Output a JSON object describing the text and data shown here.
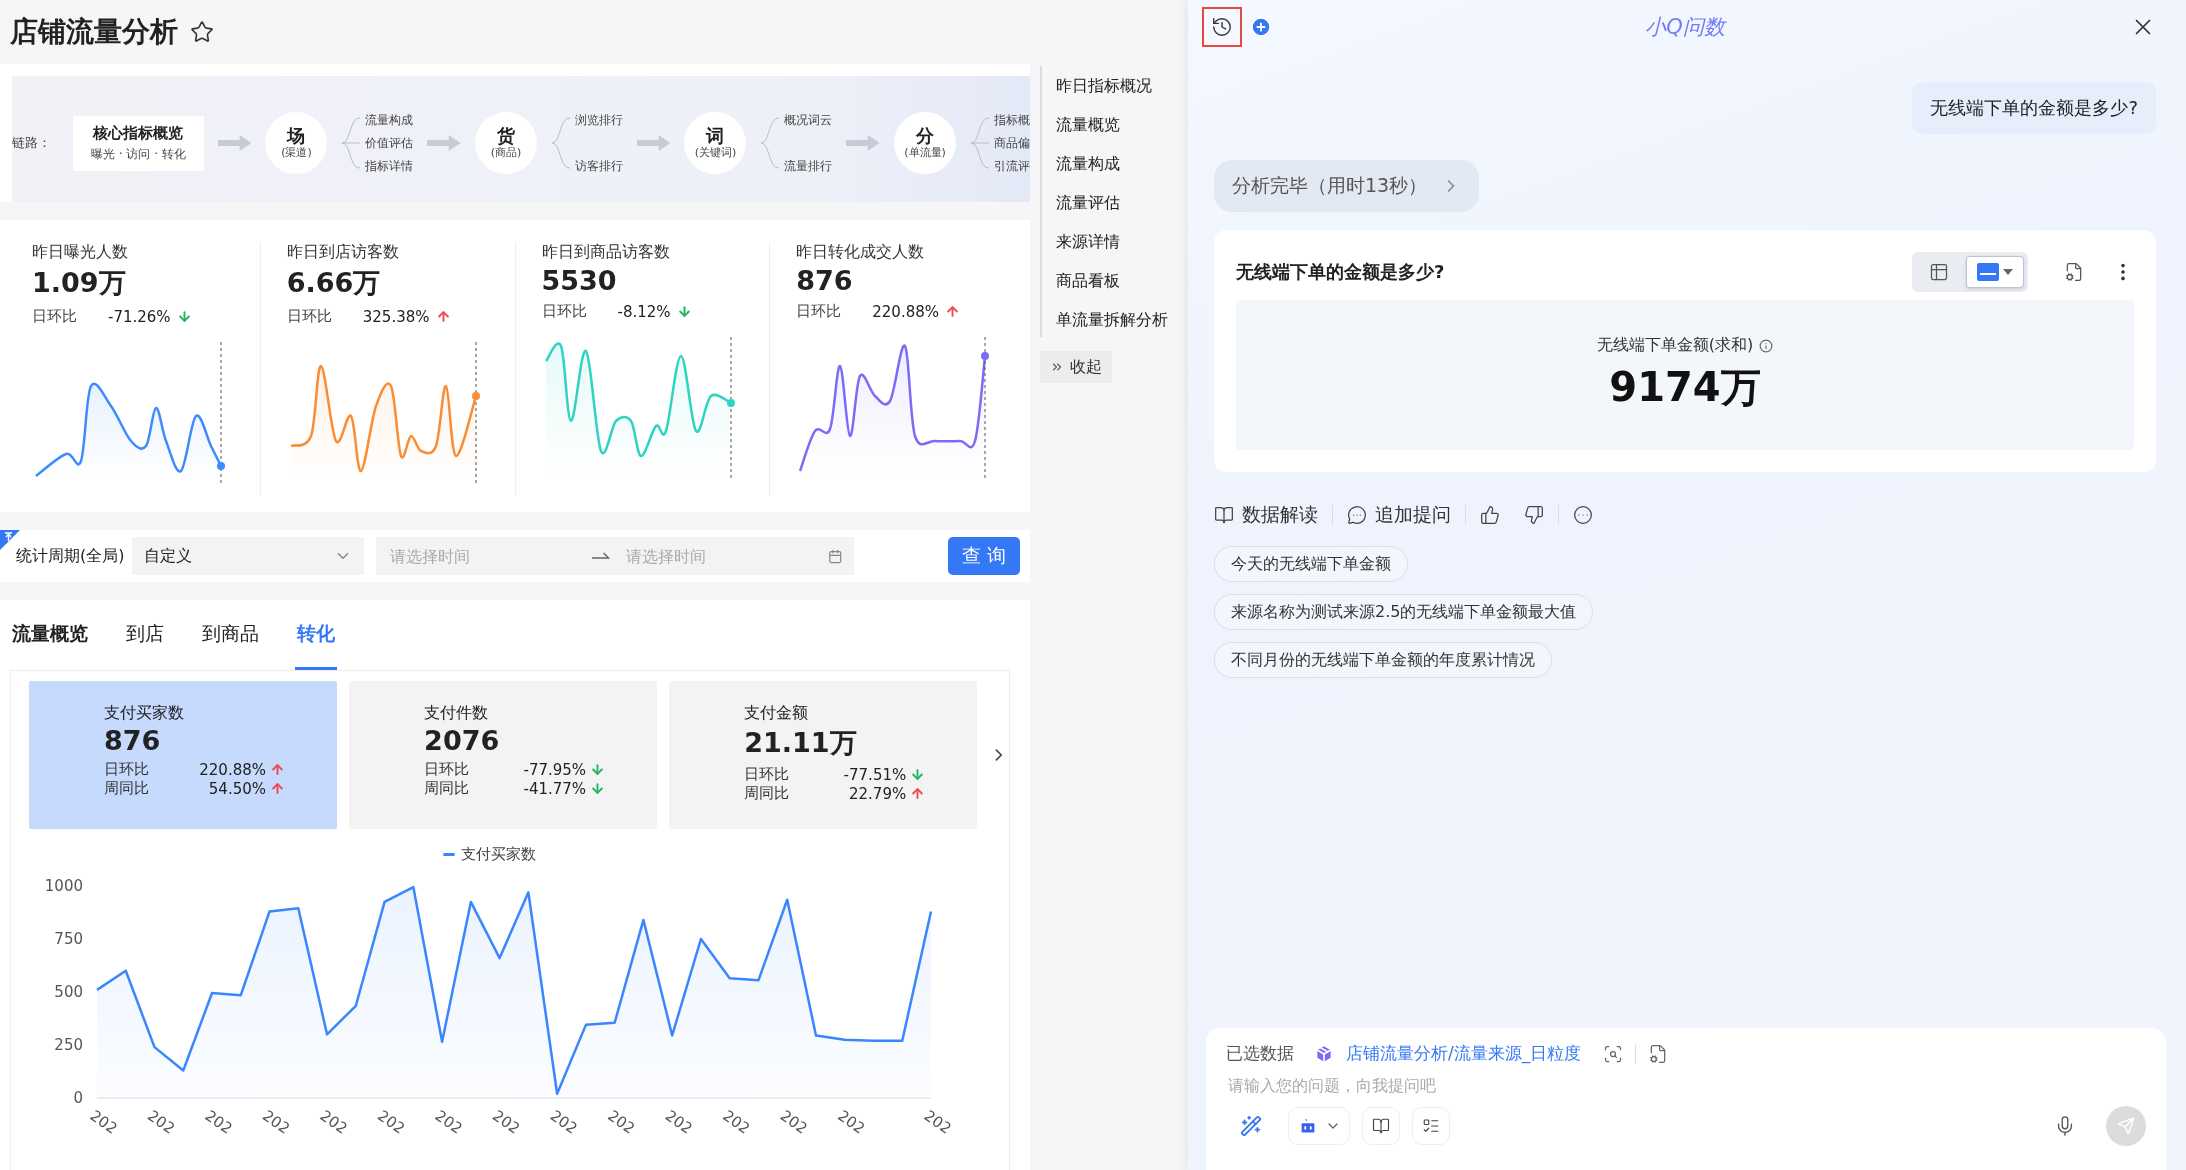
{
  "page": {
    "title": "店铺流量分析"
  },
  "flow": {
    "lead": "链路：",
    "core": {
      "title": "核心指标概览",
      "sub": "曝光 · 访问 · 转化"
    },
    "nodes": [
      {
        "title": "场",
        "sub": "(渠道)",
        "branches": [
          "流量构成",
          "价值评估",
          "指标详情"
        ]
      },
      {
        "title": "货",
        "sub": "(商品)",
        "branches": [
          "浏览排行",
          "访客排行"
        ]
      },
      {
        "title": "词",
        "sub": "(关键词)",
        "branches": [
          "概况词云",
          "流量排行"
        ]
      },
      {
        "title": "分",
        "sub": "(单流量)",
        "branches": [
          "指标概",
          "商品偏",
          "引流评"
        ]
      }
    ]
  },
  "metrics": [
    {
      "label": "昨日曝光人数",
      "value": "1.09万",
      "change_label": "日环比",
      "change": "-71.26%",
      "up": false,
      "color": "#3d8bfd"
    },
    {
      "label": "昨日到店访客数",
      "value": "6.66万",
      "change_label": "日环比",
      "change": "325.38%",
      "up": true,
      "color": "#fb8c33"
    },
    {
      "label": "昨日到商品访客数",
      "value": "5530",
      "change_label": "日环比",
      "change": "-8.12%",
      "up": false,
      "color": "#2dd4c4"
    },
    {
      "label": "昨日转化成交人数",
      "value": "876",
      "change_label": "日环比",
      "change": "220.88%",
      "up": true,
      "color": "#7b6cf6"
    }
  ],
  "filter": {
    "label": "统计周期(全局)",
    "select": "自定义",
    "start_placeholder": "请选择时间",
    "end_placeholder": "请选择时间",
    "button": "查 询"
  },
  "tabs": [
    {
      "label": "流量概览",
      "selected": false
    },
    {
      "label": "到店",
      "selected": false
    },
    {
      "label": "到商品",
      "selected": false
    },
    {
      "label": "转化",
      "selected": true
    }
  ],
  "kpi_cards": [
    {
      "title": "支付买家数",
      "value": "876",
      "selected": true,
      "rows": [
        {
          "label": "日环比",
          "value": "220.88%",
          "up": true
        },
        {
          "label": "周同比",
          "value": "54.50%",
          "up": true
        }
      ]
    },
    {
      "title": "支付件数",
      "value": "2076",
      "selected": false,
      "rows": [
        {
          "label": "日环比",
          "value": "-77.95%",
          "up": false
        },
        {
          "label": "周同比",
          "value": "-41.77%",
          "up": false
        }
      ]
    },
    {
      "title": "支付金额",
      "value": "21.11万",
      "selected": false,
      "rows": [
        {
          "label": "日环比",
          "value": "-77.51%",
          "up": false
        },
        {
          "label": "周同比",
          "value": "22.79%",
          "up": true
        }
      ]
    }
  ],
  "chart": {
    "chart_data": {
      "type": "area",
      "ylim": [
        0,
        1000
      ],
      "yticks": [
        0,
        250,
        500,
        750,
        1000
      ],
      "categories": [
        "202",
        null,
        "202",
        null,
        "202",
        null,
        "202",
        null,
        "202",
        null,
        "202",
        null,
        "202",
        null,
        "202",
        null,
        "202",
        null,
        "202",
        null,
        "202",
        null,
        "202",
        null,
        "202",
        null,
        "202",
        null,
        null,
        "202"
      ],
      "series": [
        {
          "name": "支付买家数",
          "color": "#3a86ff",
          "values": [
            510,
            600,
            240,
            130,
            495,
            485,
            880,
            895,
            300,
            435,
            925,
            995,
            265,
            925,
            660,
            970,
            20,
            345,
            355,
            840,
            295,
            750,
            565,
            555,
            935,
            295,
            275,
            270,
            270,
            880
          ]
        }
      ]
    }
  },
  "side_nav": {
    "items": [
      "昨日指标概况",
      "流量概览",
      "流量构成",
      "流量评估",
      "来源详情",
      "商品看板",
      "单流量拆解分析"
    ],
    "collapse": "收起"
  },
  "assistant": {
    "title": "小Q问数",
    "user_message": "无线端下单的金额是多少?",
    "status": "分析完毕（用时13秒）",
    "result": {
      "question": "无线端下单的金额是多少?",
      "views": [
        {
          "kind": "table",
          "selected": false
        },
        {
          "kind": "kpi",
          "selected": true
        }
      ],
      "metric_label": "无线端下单金额(求和)",
      "metric_value": "9174万"
    },
    "actions": [
      "数据解读",
      "追加提问"
    ],
    "suggestions": [
      "今天的无线端下单金额",
      "来源名称为测试来源2.5的无线端下单金额最大值",
      "不同月份的无线端下单金额的年度累计情况"
    ],
    "input": {
      "selected_label": "已选数据",
      "dataset": "店铺流量分析/流量来源_日粒度",
      "placeholder": "请输入您的问题，向我提问吧"
    }
  }
}
